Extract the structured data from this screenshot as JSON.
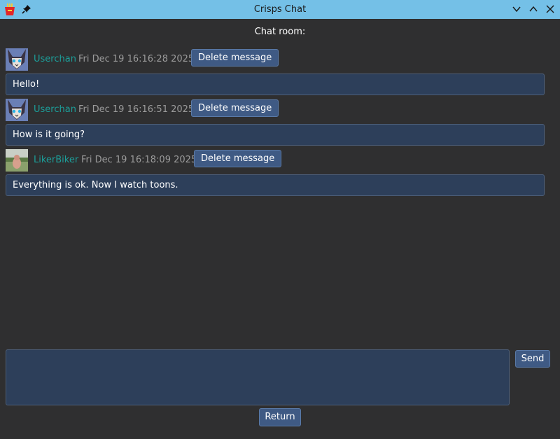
{
  "window": {
    "title": "Crisps Chat",
    "icons": {
      "app": "crisps-bucket-icon",
      "pin": "pin-icon",
      "minimize": "chevron-down-icon",
      "maximize": "chevron-up-icon",
      "close": "close-icon"
    }
  },
  "room": {
    "title": "Chat room:"
  },
  "messages": [
    {
      "user": "Userchan",
      "timestamp": "Fri Dec 19 16:16:28 2025",
      "delete_label": "Delete message",
      "text": "Hello!",
      "avatar": "cat-avatar"
    },
    {
      "user": "Userchan",
      "timestamp": "Fri Dec 19 16:16:51 2025",
      "delete_label": "Delete message",
      "text": "How is it going?",
      "avatar": "cat-avatar"
    },
    {
      "user": "LikerBiker",
      "timestamp": "Fri Dec 19 16:18:09 2025",
      "delete_label": "Delete message",
      "text": "Everything is ok. Now I watch toons.",
      "avatar": "photo-avatar"
    }
  ],
  "composer": {
    "value": "",
    "send_label": "Send"
  },
  "footer": {
    "return_label": "Return"
  },
  "colors": {
    "titlebar": "#74c0e7",
    "background": "#2f2f30",
    "username": "#1c9f9a",
    "timestamp": "#9b9b9b",
    "button": "#3f5a84",
    "message_bg": "#2d3f5a"
  }
}
